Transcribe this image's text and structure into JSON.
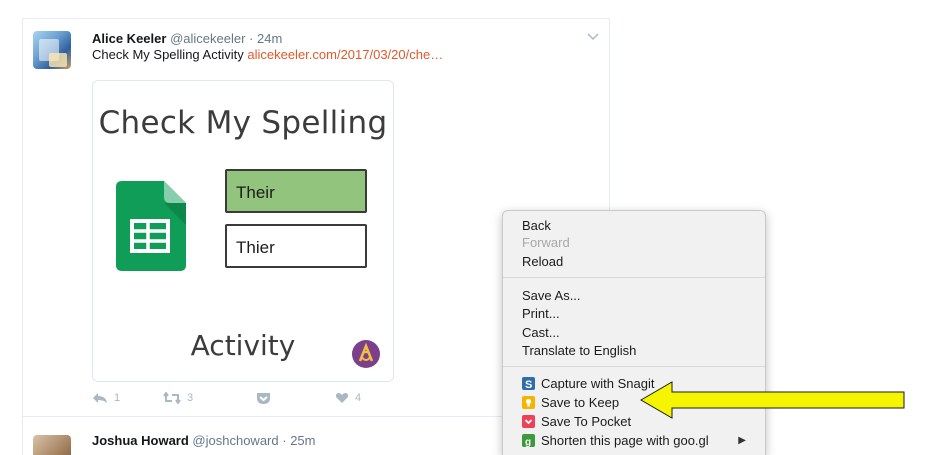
{
  "tweets": [
    {
      "name": "Alice Keeler",
      "handle": "@alicekeeler",
      "time": "24m",
      "text": "Check My Spelling Activity",
      "link": "alicekeeler.com/2017/03/20/che…",
      "media": {
        "title": "Check My Spelling",
        "option_correct": "Their",
        "option_wrong": "Thier",
        "footer": "Activity"
      },
      "actions": {
        "reply_count": "1",
        "retweet_count": "3",
        "like_count": "4"
      }
    },
    {
      "name": "Joshua Howard",
      "handle": "@joshchoward",
      "time": "25m"
    }
  ],
  "context_menu": {
    "items": [
      {
        "label": "Back",
        "enabled": true
      },
      {
        "label": "Forward",
        "enabled": false
      },
      {
        "label": "Reload",
        "enabled": true
      },
      {
        "label": "Save As...",
        "enabled": true
      },
      {
        "label": "Print...",
        "enabled": true
      },
      {
        "label": "Cast...",
        "enabled": true
      },
      {
        "label": "Translate to English",
        "enabled": true
      },
      {
        "label": "Capture with Snagit",
        "enabled": true,
        "icon": "snagit-icon"
      },
      {
        "label": "Save to Keep",
        "enabled": true,
        "icon": "keep-icon"
      },
      {
        "label": "Save To Pocket",
        "enabled": true,
        "icon": "pocket-icon"
      },
      {
        "label": "Shorten this page with goo.gl",
        "enabled": true,
        "icon": "googl-icon",
        "submenu": true
      }
    ]
  },
  "colors": {
    "link": "#e0592a",
    "highlight_arrow": "#f5f500",
    "correct_box": "#93c47d",
    "sheets_green": "#0f9d58"
  }
}
